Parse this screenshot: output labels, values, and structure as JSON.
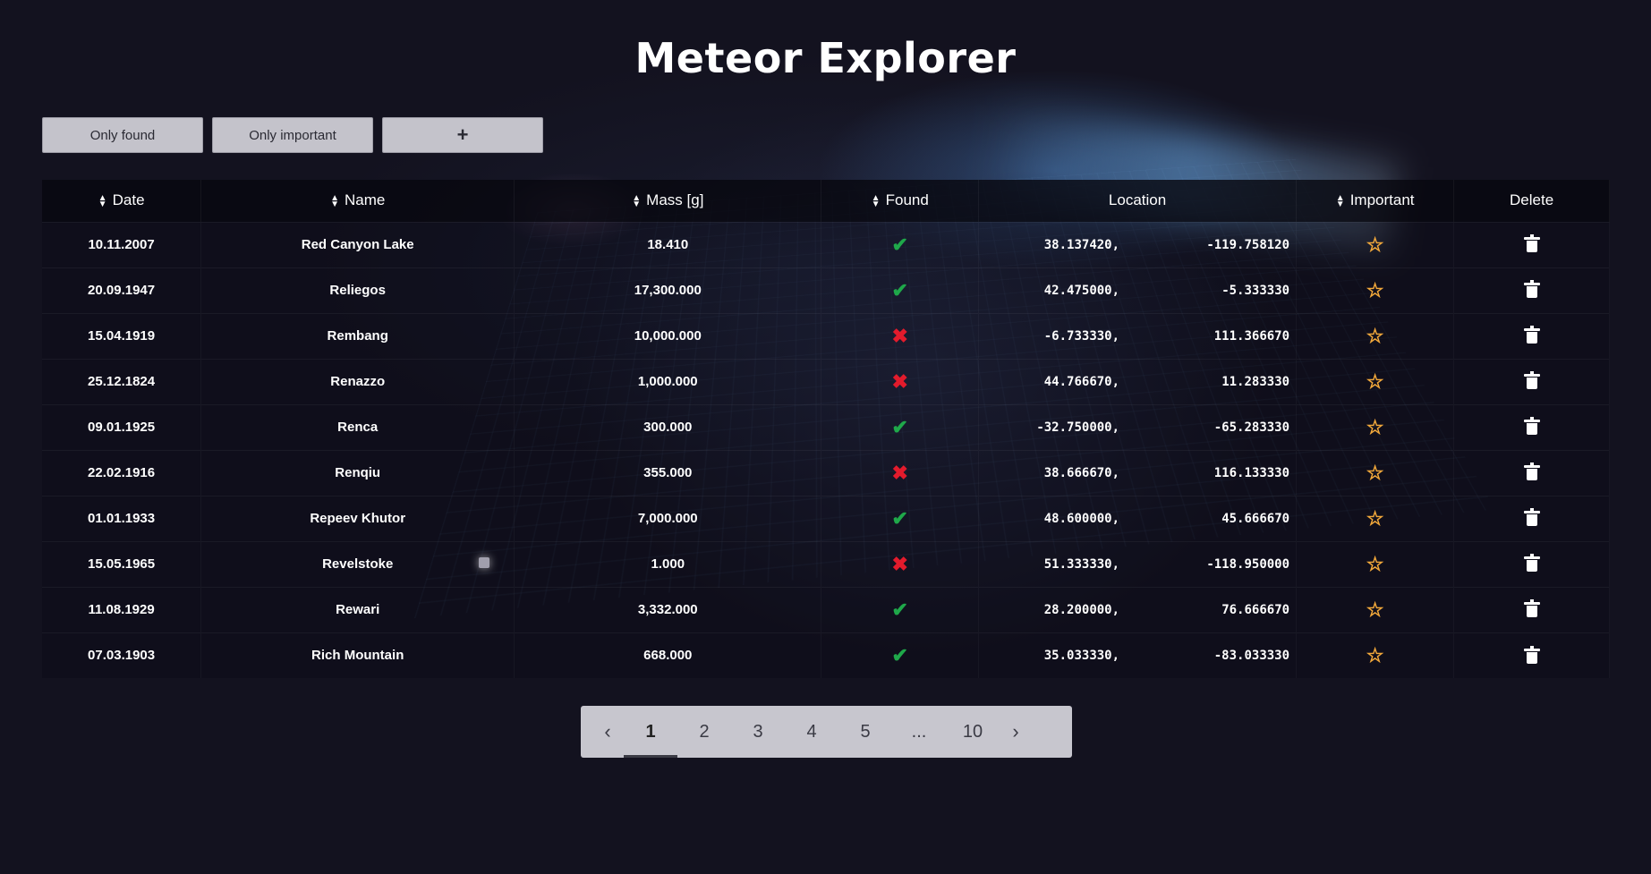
{
  "title": "Meteor Explorer",
  "toolbar": {
    "only_found": "Only found",
    "only_important": "Only important",
    "add": "+"
  },
  "columns": {
    "date": "Date",
    "name": "Name",
    "mass": "Mass [g]",
    "found": "Found",
    "location": "Location",
    "important": "Important",
    "delete": "Delete"
  },
  "rows": [
    {
      "date": "10.11.2007",
      "name": "Red Canyon Lake",
      "mass": "18.410",
      "found": true,
      "lat": "38.137420,",
      "lon": "-119.758120"
    },
    {
      "date": "20.09.1947",
      "name": "Reliegos",
      "mass": "17,300.000",
      "found": true,
      "lat": "42.475000,",
      "lon": "-5.333330"
    },
    {
      "date": "15.04.1919",
      "name": "Rembang",
      "mass": "10,000.000",
      "found": false,
      "lat": "-6.733330,",
      "lon": "111.366670"
    },
    {
      "date": "25.12.1824",
      "name": "Renazzo",
      "mass": "1,000.000",
      "found": false,
      "lat": "44.766670,",
      "lon": "11.283330"
    },
    {
      "date": "09.01.1925",
      "name": "Renca",
      "mass": "300.000",
      "found": true,
      "lat": "-32.750000,",
      "lon": "-65.283330"
    },
    {
      "date": "22.02.1916",
      "name": "Renqiu",
      "mass": "355.000",
      "found": false,
      "lat": "38.666670,",
      "lon": "116.133330"
    },
    {
      "date": "01.01.1933",
      "name": "Repeev Khutor",
      "mass": "7,000.000",
      "found": true,
      "lat": "48.600000,",
      "lon": "45.666670"
    },
    {
      "date": "15.05.1965",
      "name": "Revelstoke",
      "mass": "1.000",
      "found": false,
      "lat": "51.333330,",
      "lon": "-118.950000"
    },
    {
      "date": "11.08.1929",
      "name": "Rewari",
      "mass": "3,332.000",
      "found": true,
      "lat": "28.200000,",
      "lon": "76.666670"
    },
    {
      "date": "07.03.1903",
      "name": "Rich Mountain",
      "mass": "668.000",
      "found": true,
      "lat": "35.033330,",
      "lon": "-83.033330"
    }
  ],
  "icons": {
    "found_yes": "check-icon",
    "found_no": "cross-icon",
    "important": "star-outline-icon",
    "delete": "trash-icon",
    "sort": "sort-icon"
  },
  "colors": {
    "check": "#1fa84a",
    "cross": "#e31b2c",
    "star": "#f3a93b"
  },
  "pagination": {
    "pages": [
      "1",
      "2",
      "3",
      "4",
      "5",
      "...",
      "10"
    ],
    "current": "1"
  }
}
